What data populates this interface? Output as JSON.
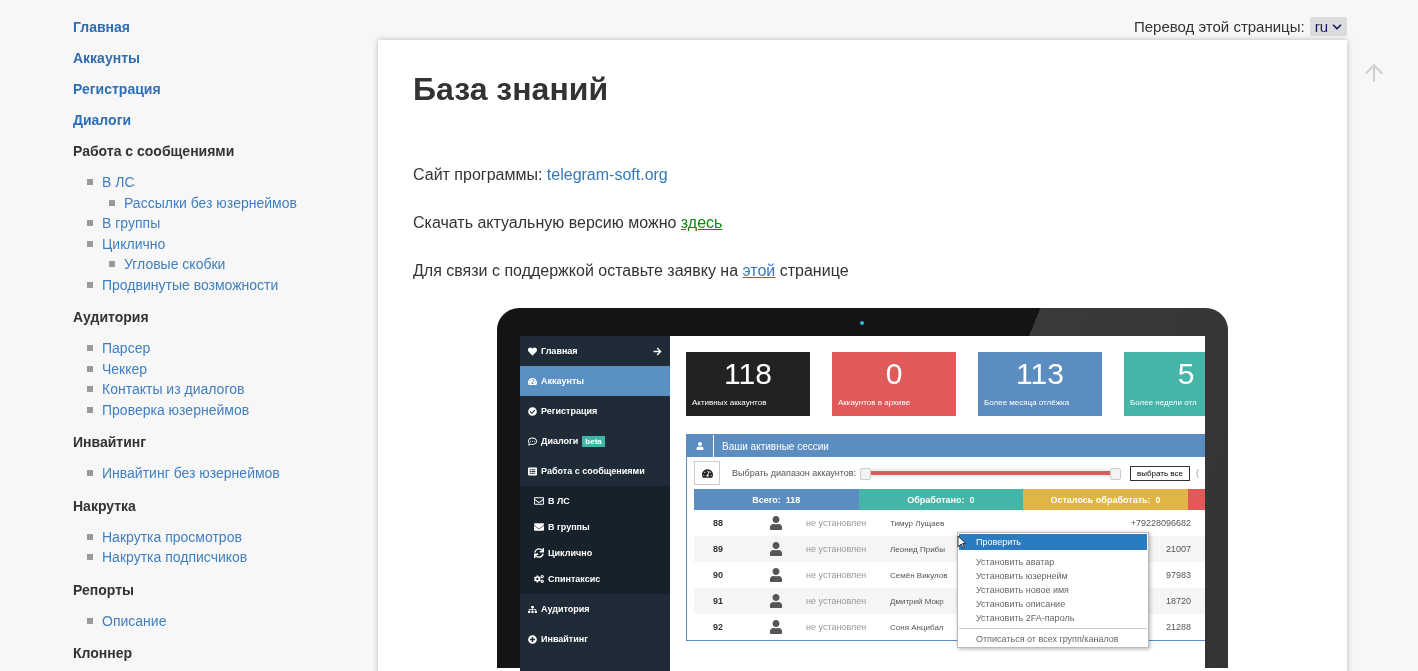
{
  "sidebar": {
    "sections": [
      {
        "kind": "link",
        "label": "Главная"
      },
      {
        "kind": "link",
        "label": "Аккаунты"
      },
      {
        "kind": "link",
        "label": "Регистрация"
      },
      {
        "kind": "link",
        "label": "Диалоги"
      },
      {
        "kind": "heading",
        "label": "Работа с сообщениями",
        "items": [
          {
            "label": "В ЛС",
            "children": [
              {
                "label": "Рассылки без юзернеймов"
              }
            ]
          },
          {
            "label": "В группы"
          },
          {
            "label": "Циклично",
            "children": [
              {
                "label": "Угловые скобки"
              }
            ]
          },
          {
            "label": "Продвинутые возможности"
          }
        ]
      },
      {
        "kind": "heading",
        "label": "Аудитория",
        "items": [
          {
            "label": "Парсер"
          },
          {
            "label": "Чеккер"
          },
          {
            "label": "Контакты из диалогов"
          },
          {
            "label": "Проверка юзернеймов"
          }
        ]
      },
      {
        "kind": "heading",
        "label": "Инвайтинг",
        "items": [
          {
            "label": "Инвайтинг без юзернеймов"
          }
        ]
      },
      {
        "kind": "heading",
        "label": "Накрутка",
        "items": [
          {
            "label": "Накрутка просмотров"
          },
          {
            "label": "Накрутка подписчиков"
          }
        ]
      },
      {
        "kind": "heading",
        "label": "Репорты",
        "items": [
          {
            "label": "Описание"
          }
        ]
      },
      {
        "kind": "heading",
        "label": "Клоннер"
      }
    ]
  },
  "translation": {
    "label": "Перевод этой страницы:",
    "value": "ru"
  },
  "article": {
    "title": "База знаний",
    "paragraphs": [
      {
        "before": "Сайт программы: ",
        "link": {
          "text": "telegram-soft.org",
          "kind": "plain"
        }
      },
      {
        "before": "Скачать актуальную версию можно ",
        "link": {
          "text": "здесь",
          "kind": "visited"
        }
      },
      {
        "before": "Для связи с поддержкой оставьте заявку на ",
        "link": {
          "text": "этой",
          "kind": "underlined"
        },
        "after": " странице"
      }
    ]
  },
  "app_screenshot": {
    "nav": [
      {
        "label": "Главная",
        "selected": false
      },
      {
        "label": "Аккаунты",
        "selected": true
      },
      {
        "label": "Регистрация",
        "selected": false
      },
      {
        "label": "Диалоги",
        "selected": false,
        "badge": "beta"
      },
      {
        "label": "Работа с сообщениями",
        "selected": false,
        "children": [
          {
            "label": "В ЛС"
          },
          {
            "label": "В группы"
          },
          {
            "label": "Циклично"
          },
          {
            "label": "Спинтаксис"
          }
        ]
      },
      {
        "label": "Аудитория",
        "selected": false
      },
      {
        "label": "Инвайтинг",
        "selected": false
      }
    ],
    "stats": [
      {
        "value": "118",
        "label": "Активных аккаунтов",
        "color": "#222222"
      },
      {
        "value": "0",
        "label": "Аккаунтов в архиве",
        "color": "#e05a5a"
      },
      {
        "value": "113",
        "label": "Более месяца отлёжка",
        "color": "#5b8dc0"
      },
      {
        "value": "5",
        "label": "Более недели отл",
        "color": "#45b5a8"
      }
    ],
    "panel_title": "Ваши активные сессии",
    "range_label": "Выбрать диапазон аккаунтов:",
    "range": {
      "level": 1
    },
    "select_all": "выбрать все",
    "range_hint": "(",
    "totals": [
      {
        "text": "Всего:  118",
        "color": "#5b8dc0"
      },
      {
        "text": "Обработано:  0",
        "color": "#45b5a8"
      },
      {
        "text": "Осталось обработать:  0",
        "color": "#dfb545"
      },
      {
        "color": "#e05a5a"
      }
    ],
    "rows": [
      {
        "number": "88",
        "username": "не установлен",
        "name": "Тимур Лущаев",
        "phone": "+79228096682"
      },
      {
        "number": "89",
        "username": "не установлен",
        "name": "Леонид Прибы",
        "phone": "21007"
      },
      {
        "number": "90",
        "username": "не установлен",
        "name": "Семён Викулов",
        "phone": "97983"
      },
      {
        "number": "91",
        "username": "не установлен",
        "name": "Дмитрий Мокр",
        "phone": "18720"
      },
      {
        "number": "92",
        "username": "не установлен",
        "name": "Соня Анцибал",
        "phone": "21288"
      }
    ],
    "context_menu": [
      {
        "kind": "item",
        "label": "Проверить",
        "selected": true
      },
      {
        "kind": "item",
        "label": "Установить аватар",
        "selected": false
      },
      {
        "kind": "item",
        "label": "Установить юзернейм",
        "selected": false
      },
      {
        "kind": "item",
        "label": "Установить новое имя",
        "selected": false
      },
      {
        "kind": "item",
        "label": "Установить описание",
        "selected": false
      },
      {
        "kind": "item",
        "label": "Установить 2FA-пароль",
        "selected": false
      },
      {
        "kind": "divider"
      },
      {
        "kind": "item",
        "label": "Отписаться от всех групп/каналов",
        "selected": false
      }
    ]
  }
}
